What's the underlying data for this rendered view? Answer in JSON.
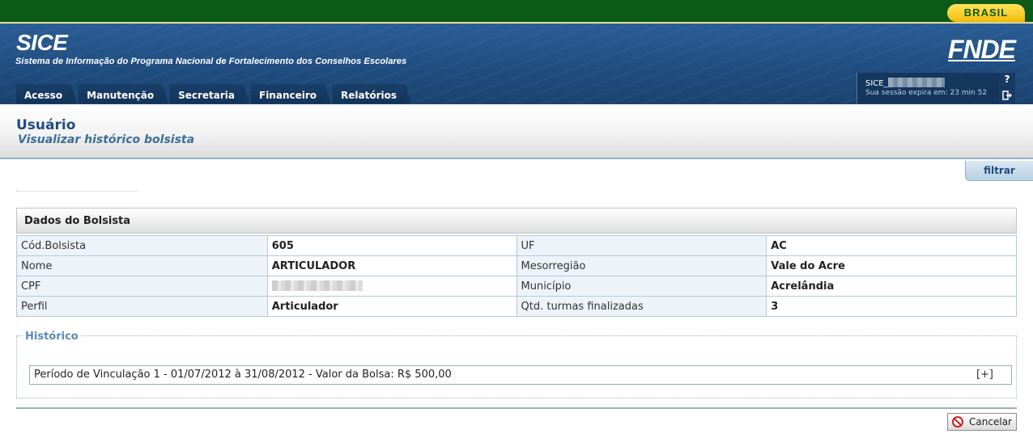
{
  "gov_bar": {
    "brand": "BRASIL"
  },
  "header": {
    "app_title": "SICE",
    "app_subtitle": "Sistema de Informação do Programa Nacional de Fortalecimento dos Conselhos Escolares",
    "logo": "FNDE"
  },
  "menu": {
    "items": [
      {
        "label": "Acesso"
      },
      {
        "label": "Manutenção"
      },
      {
        "label": "Secretaria"
      },
      {
        "label": "Financeiro"
      },
      {
        "label": "Relatórios"
      }
    ]
  },
  "session": {
    "user_prefix": "SICE_",
    "expire_text": "Sua sessão expira em: 23 min 52",
    "help_symbol": "?",
    "help_icon": "help-icon",
    "logout_icon": "logout-icon"
  },
  "page": {
    "title": "Usuário",
    "subtitle": "Visualizar histórico bolsista",
    "filter_label": "filtrar"
  },
  "bolsista": {
    "section_title": "Dados do Bolsista",
    "rows": [
      {
        "label1": "Cód.Bolsista",
        "value1": "605",
        "label2": "UF",
        "value2": "AC"
      },
      {
        "label1": "Nome",
        "value1": "ARTICULADOR",
        "label2": "Mesorregião",
        "value2": "Vale do Acre"
      },
      {
        "label1": "CPF",
        "value1": "",
        "label2": "Município",
        "value2": "Acrelândia"
      },
      {
        "label1": "Perfil",
        "value1": "Articulador",
        "label2": "Qtd. turmas finalizadas",
        "value2": "3"
      }
    ]
  },
  "historico": {
    "legend": "Histórico",
    "periods": [
      {
        "text": "Período de Vinculação 1 - 01/07/2012 à 31/08/2012 - Valor da Bolsa: R$ 500,00",
        "expand": "[+]"
      }
    ]
  },
  "actions": {
    "cancel_label": "Cancelar",
    "cancel_icon": "cancel-icon"
  },
  "colors": {
    "gov_green": "#0b5a17",
    "header_blue": "#1f4c7f",
    "accent_gold": "#f2bd0c",
    "border_blue": "#8fb0c8"
  }
}
